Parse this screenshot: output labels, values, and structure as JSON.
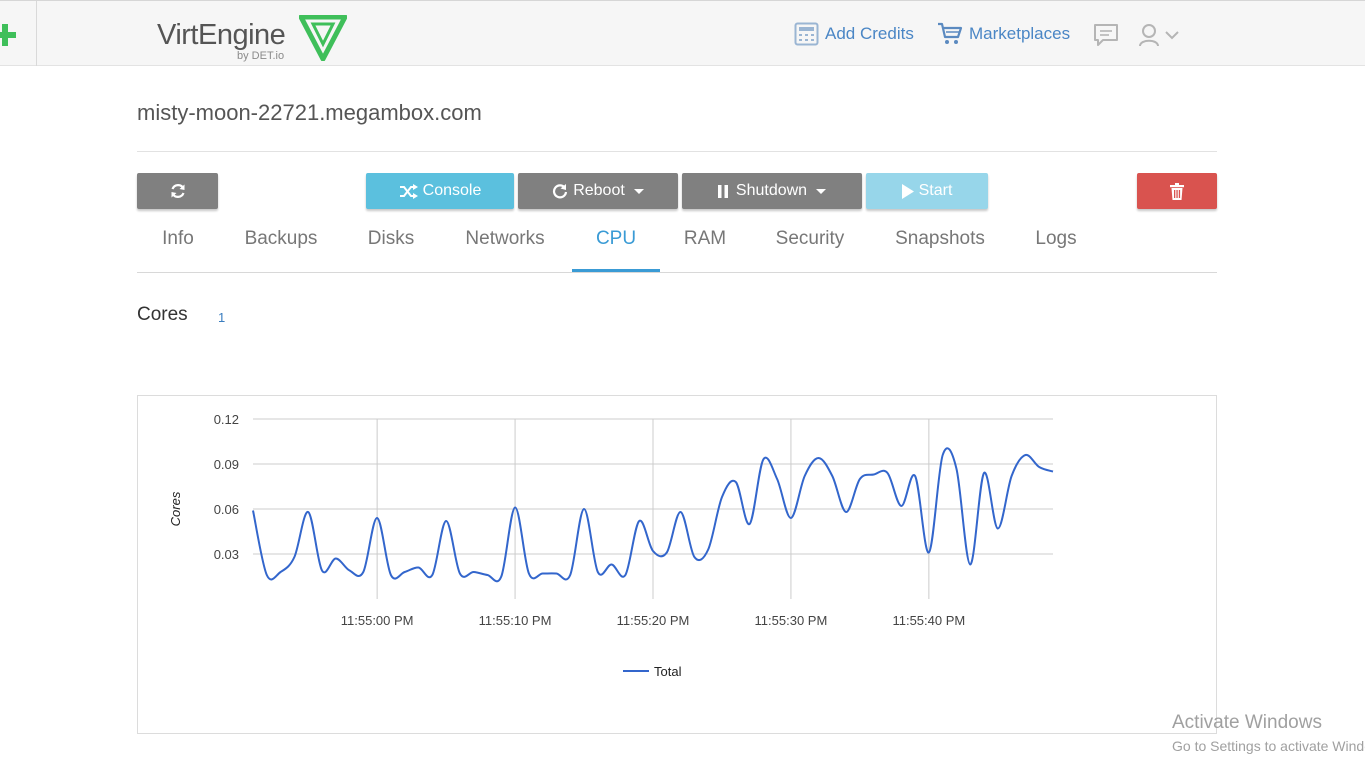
{
  "header": {
    "logo_text": "VirtEngine",
    "logo_subtext": "by DET.io",
    "add_credits_label": "Add Credits",
    "marketplaces_label": "Marketplaces",
    "icons": [
      "plus-icon",
      "calculator-icon",
      "cart-icon",
      "message-icon",
      "user-icon",
      "chevron-down-icon"
    ],
    "accent_color": "#4a86c5",
    "brand_green": "#3fbf5a"
  },
  "page": {
    "hostname": "misty-moon-22721.megambox.com"
  },
  "toolbar": {
    "console_label": "Console",
    "reboot_label": "Reboot",
    "shutdown_label": "Shutdown",
    "start_label": "Start",
    "icons": [
      "refresh-icon",
      "shuffle-icon",
      "reboot-icon",
      "pause-icon",
      "play-icon",
      "trash-icon"
    ]
  },
  "tabs": [
    {
      "label": "Info"
    },
    {
      "label": "Backups"
    },
    {
      "label": "Disks"
    },
    {
      "label": "Networks"
    },
    {
      "label": "CPU",
      "active": true
    },
    {
      "label": "RAM"
    },
    {
      "label": "Security"
    },
    {
      "label": "Snapshots"
    },
    {
      "label": "Logs"
    }
  ],
  "cpu": {
    "cores_label": "Cores",
    "cores_value": "1"
  },
  "chart_data": {
    "type": "line",
    "title": "",
    "xlabel": "",
    "ylabel": "Cores",
    "ylim": [
      0,
      0.12
    ],
    "y_ticks": [
      "0.03",
      "0.06",
      "0.09",
      "0.12"
    ],
    "x_ticks": [
      "11:55:00 PM",
      "11:55:10 PM",
      "11:55:20 PM",
      "11:55:30 PM",
      "11:55:40 PM"
    ],
    "x_range_seconds_from_tick0": [
      -9,
      49
    ],
    "grid": true,
    "legend_position": "bottom",
    "series": [
      {
        "name": "Total",
        "color": "#3366cc",
        "x": [
          -9,
          -8,
          -7,
          -6,
          -5,
          -4,
          -3,
          -2,
          -1,
          0,
          1,
          2,
          3,
          4,
          5,
          6,
          7,
          8,
          9,
          10,
          11,
          12,
          13,
          14,
          15,
          16,
          17,
          18,
          19,
          20,
          21,
          22,
          23,
          24,
          25,
          26,
          27,
          28,
          29,
          30,
          31,
          32,
          33,
          34,
          35,
          36,
          37,
          38,
          39,
          40,
          41,
          42,
          43,
          44,
          45,
          46,
          47,
          48,
          49
        ],
        "values": [
          0.059,
          0.016,
          0.018,
          0.028,
          0.058,
          0.019,
          0.027,
          0.019,
          0.018,
          0.054,
          0.016,
          0.018,
          0.021,
          0.016,
          0.052,
          0.017,
          0.018,
          0.016,
          0.015,
          0.061,
          0.017,
          0.017,
          0.017,
          0.016,
          0.06,
          0.018,
          0.023,
          0.016,
          0.052,
          0.032,
          0.031,
          0.058,
          0.028,
          0.033,
          0.068,
          0.078,
          0.05,
          0.093,
          0.08,
          0.054,
          0.082,
          0.094,
          0.082,
          0.058,
          0.08,
          0.083,
          0.084,
          0.062,
          0.082,
          0.031,
          0.096,
          0.087,
          0.023,
          0.084,
          0.047,
          0.082,
          0.096,
          0.088,
          0.085
        ]
      }
    ]
  },
  "watermark": {
    "line1": "Activate Windows",
    "line2": "Go to Settings to activate Windows."
  }
}
